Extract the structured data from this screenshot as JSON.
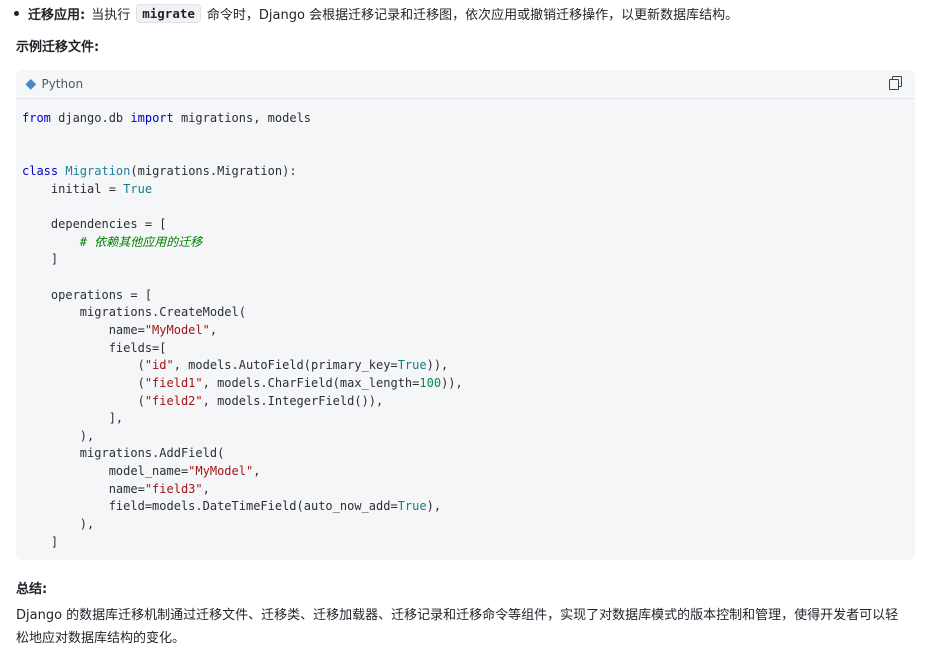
{
  "bullet": {
    "label": "迁移应用:",
    "text_before": "当执行",
    "code": "migrate",
    "text_after": "命令时，Django 会根据迁移记录和迁移图，依次应用或撤销迁移操作，以更新数据库结构。"
  },
  "example_heading": "示例迁移文件:",
  "code_block": {
    "language": "Python",
    "language_icon": "python-diamond-icon",
    "copy_icon": "copy-icon"
  },
  "summary": {
    "title": "总结:",
    "text": "Django 的数据库迁移机制通过迁移文件、迁移类、迁移加载器、迁移记录和迁移命令等组件，实现了对数据库模式的版本控制和管理，使得开发者可以轻松地应对数据库结构的变化。"
  }
}
